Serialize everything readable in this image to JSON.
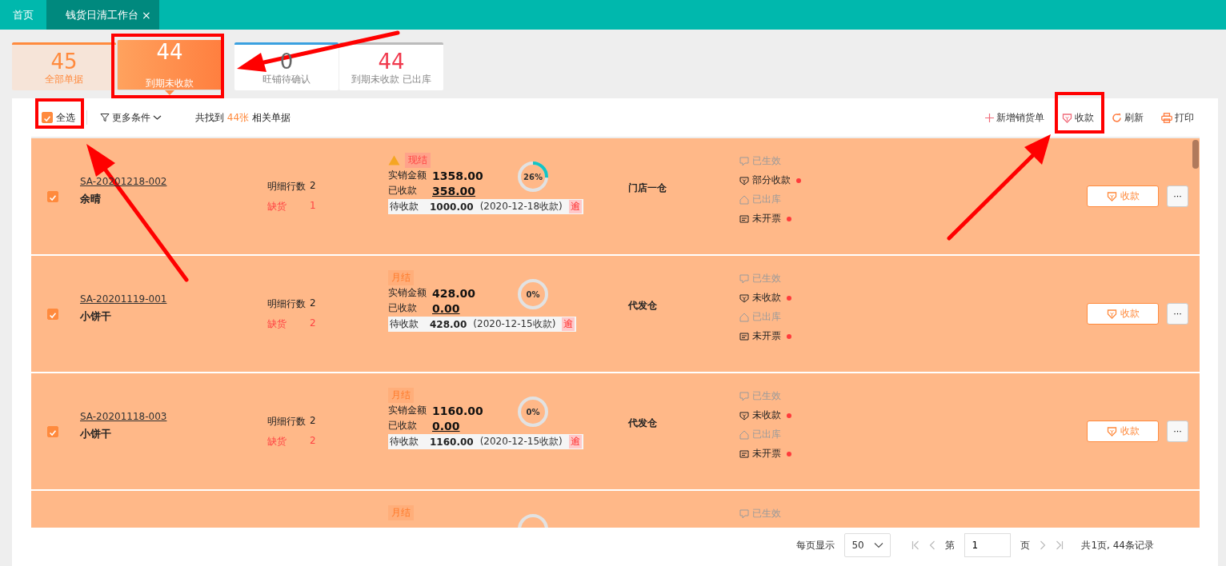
{
  "nav_tabs": [
    {
      "label": "首页",
      "selected": false,
      "closable": false
    },
    {
      "label": "钱货日清工作台",
      "selected": true,
      "closable": true
    }
  ],
  "close_glyph": "×",
  "stat_cards": [
    {
      "count": "45",
      "label": "全部单据",
      "selected": false,
      "color": "#ff8a3d"
    },
    {
      "count": "44",
      "label": "到期未收款",
      "selected": true,
      "color": "#ff8a3d"
    },
    {
      "count": "0",
      "label": "旺铺待确认",
      "selected": false,
      "color": "#3aa0e0"
    },
    {
      "count": "44",
      "label": "到期未收款 已出库",
      "selected": false,
      "color": "#bbbbbb"
    }
  ],
  "toolbar": {
    "select_all": {
      "label": "全选",
      "checked": true
    },
    "more_filters": "更多条件",
    "result": {
      "prefix": "共找到",
      "count": "44张",
      "suffix": "相关单据"
    },
    "actions": [
      {
        "kind": "add",
        "label": "新增销货单"
      },
      {
        "kind": "collect",
        "label": "收款"
      },
      {
        "kind": "refresh",
        "label": "刷新"
      },
      {
        "kind": "print",
        "label": "打印"
      }
    ]
  },
  "rows": [
    {
      "selected": true,
      "code": "SA-20201218-002",
      "customer": "余晴",
      "detail_label": "明细行数",
      "detail_count": "2",
      "shortage_label": "缺货",
      "shortage_count": "1",
      "warning": true,
      "settle_tag": "现结",
      "amount_label": "实销金额",
      "amount": "1358.00",
      "received_label": "已收款",
      "received": "358.00",
      "pending_label": "待收款",
      "pending": "1000.00",
      "due": "(2020-12-18收款)",
      "overdue_tag": "逾",
      "progress_text": "26%",
      "level": 0.26,
      "warehouse": "门店一仓",
      "statuses": [
        {
          "kind": "effective",
          "label": "已生效",
          "alert": false
        },
        {
          "kind": "payment",
          "label": "部分收款",
          "alert": true
        },
        {
          "kind": "outbound",
          "label": "已出库",
          "alert": false
        },
        {
          "kind": "invoice",
          "label": "未开票",
          "alert": true
        }
      ],
      "collect_button": "收款",
      "more_button": "···"
    },
    {
      "selected": true,
      "code": "SA-20201119-001",
      "customer": "小饼干",
      "detail_label": "明细行数",
      "detail_count": "2",
      "shortage_label": "缺货",
      "shortage_count": "2",
      "warning": false,
      "settle_tag": "月结",
      "amount_label": "实销金额",
      "amount": "428.00",
      "received_label": "已收款",
      "received": "0.00",
      "pending_label": "待收款",
      "pending": "428.00",
      "due": "(2020-12-15收款)",
      "overdue_tag": "逾",
      "progress_text": "0%",
      "warehouse": "代发仓",
      "statuses": [
        {
          "kind": "effective",
          "label": "已生效",
          "alert": false
        },
        {
          "kind": "payment",
          "label": "未收款",
          "alert": true
        },
        {
          "kind": "outbound",
          "label": "已出库",
          "alert": false
        },
        {
          "kind": "invoice",
          "label": "未开票",
          "alert": true
        }
      ],
      "collect_button": "收款",
      "more_button": "···"
    },
    {
      "selected": true,
      "code": "SA-20201118-003",
      "customer": "小饼干",
      "detail_label": "明细行数",
      "detail_count": "2",
      "shortage_label": "缺货",
      "shortage_count": "2",
      "warning": false,
      "settle_tag": "月结",
      "amount_label": "实销金额",
      "amount": "1160.00",
      "received_label": "已收款",
      "received": "0.00",
      "pending_label": "待收款",
      "pending": "1160.00",
      "due": "(2020-12-15收款)",
      "overdue_tag": "逾",
      "progress_text": "0%",
      "warehouse": "代发仓",
      "statuses": [
        {
          "kind": "effective",
          "label": "已生效",
          "alert": false
        },
        {
          "kind": "payment",
          "label": "未收款",
          "alert": true
        },
        {
          "kind": "outbound",
          "label": "已出库",
          "alert": false
        },
        {
          "kind": "invoice",
          "label": "未开票",
          "alert": true
        }
      ],
      "collect_button": "收款",
      "more_button": "···"
    },
    {
      "warning": false,
      "settle_tag": "月结",
      "statuses": [
        {
          "kind": "effective",
          "label": "已生效",
          "alert": false
        }
      ]
    }
  ],
  "pagination": {
    "page_size_label": "每页显示",
    "page_size": "50",
    "page_prefix": "第",
    "page": "1",
    "page_suffix": "页",
    "summary": "共1页, 44条记录"
  }
}
